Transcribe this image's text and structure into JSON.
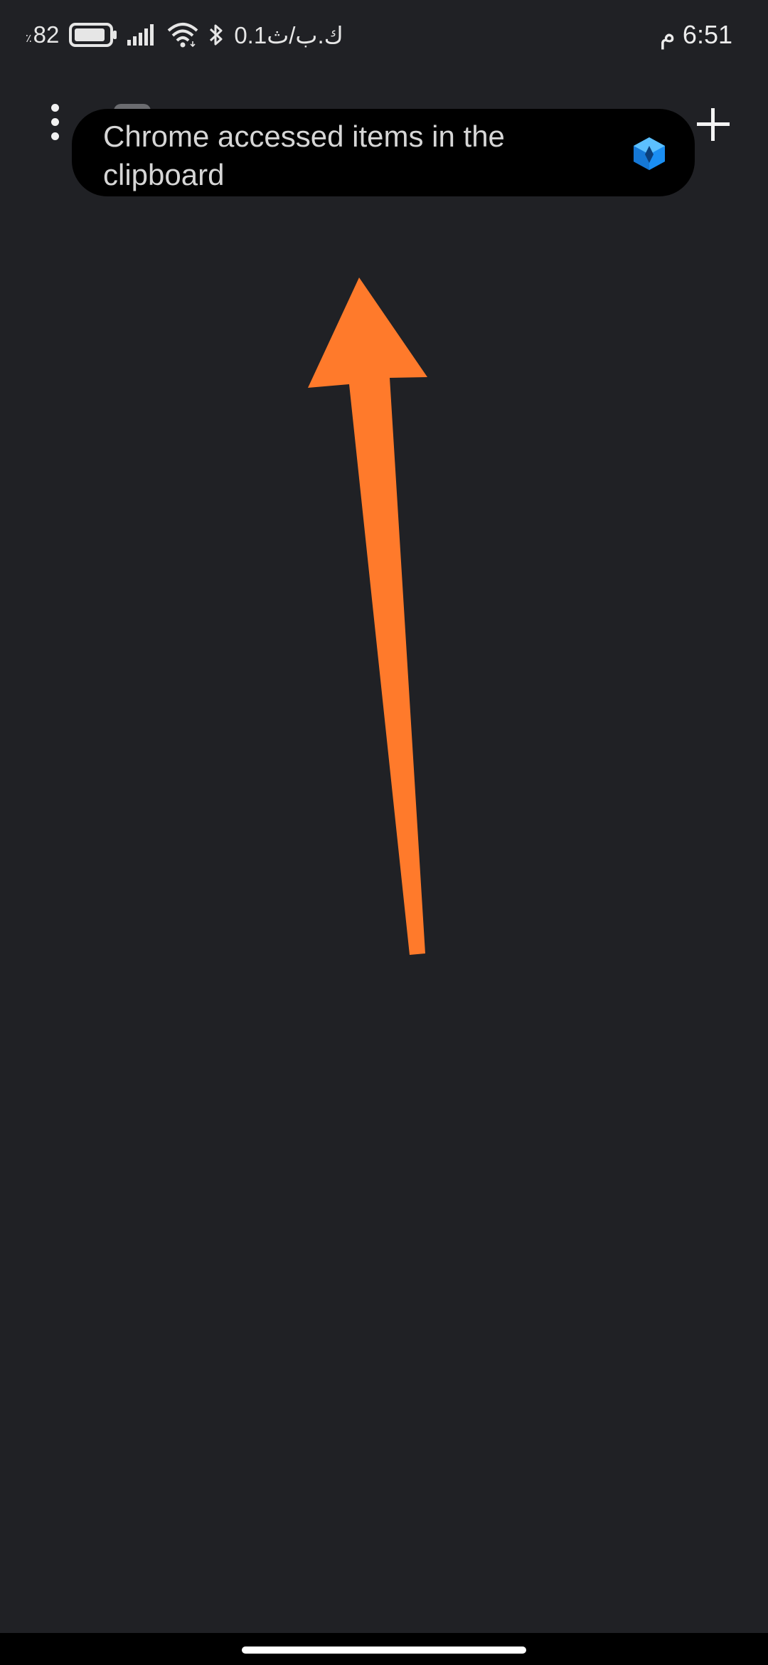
{
  "status_bar": {
    "battery_percent": "82",
    "percent_sign": "٪",
    "net_speed": "0.1ك.ب/ث",
    "time": "6:51 م",
    "icons": [
      "battery-icon",
      "signal-icon",
      "wifi-icon",
      "bluetooth-icon"
    ]
  },
  "banner": {
    "text": "Chrome accessed items in the clipboard",
    "icon": "app-cube-icon",
    "icon_color": "#1a8ef2"
  },
  "toolbar": {
    "menu_icon": "more-vert-icon",
    "new_tab_icon": "plus-icon"
  },
  "annotation": {
    "type": "arrow",
    "color": "#ff7a2b"
  },
  "colors": {
    "background": "#202125",
    "banner_background": "#000000",
    "nav_bar": "#000000"
  }
}
